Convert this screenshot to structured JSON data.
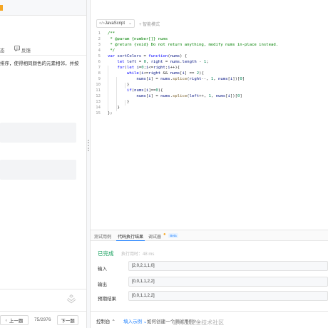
{
  "left": {
    "tabs": {
      "partial": "态",
      "feedback": "反馈"
    },
    "description": "排序，使得相同颜色的元素相邻，并按",
    "prev_label": "上一题",
    "pager": "75/2976",
    "next_label": "下一题"
  },
  "toolbar": {
    "language": "JavaScript",
    "smart_mode": "智能模式",
    "icons": {
      "language": "code-icon",
      "chevron": "chevron-down-icon",
      "smart": "plus-icon"
    }
  },
  "editor": {
    "line_numbers": [
      "1",
      "2",
      "3",
      "4",
      "5",
      "6",
      "7",
      "8",
      "9",
      "10",
      "11",
      "12",
      "13",
      "14",
      "15"
    ],
    "lines": [
      "/**",
      " * @param {number[]} nums",
      " * @return {void} Do not return anything, modify nums in-place instead.",
      " */",
      "var sortColors = function(nums) {",
      "    let left = 0, right = nums.length - 1;",
      "    for(let i=0;i<=right;i++){",
      "        while(i<=right && nums[i] == 2){",
      "            nums[i] = nums.splice(right--, 1, nums[i])[0]",
      "        }",
      "        if(nums[i]==0){",
      "            nums[i] = nums.splice(left++, 1, nums[i])[0]",
      "        }",
      "    }",
      "};"
    ]
  },
  "results": {
    "tabs": [
      "测试用例",
      "代码执行结果",
      "调试器"
    ],
    "beta": "Beta",
    "status": "已完成",
    "exec_time": "执行用时：48 ms",
    "rows": [
      {
        "label": "输入",
        "value": "[2,0,2,1,1,0]"
      },
      {
        "label": "输出",
        "value": "[0,0,1,1,2,2]"
      },
      {
        "label": "预期结果",
        "value": "[0,0,1,1,2,2]"
      }
    ]
  },
  "bottom": {
    "console": "控制台",
    "input_example": "填入示例",
    "how_to": "如何创建一个测试用例?"
  },
  "watermark": "@稀土掘金技术社区",
  "colors": {
    "accent": "#1e80ff",
    "success": "#0f9d58"
  }
}
